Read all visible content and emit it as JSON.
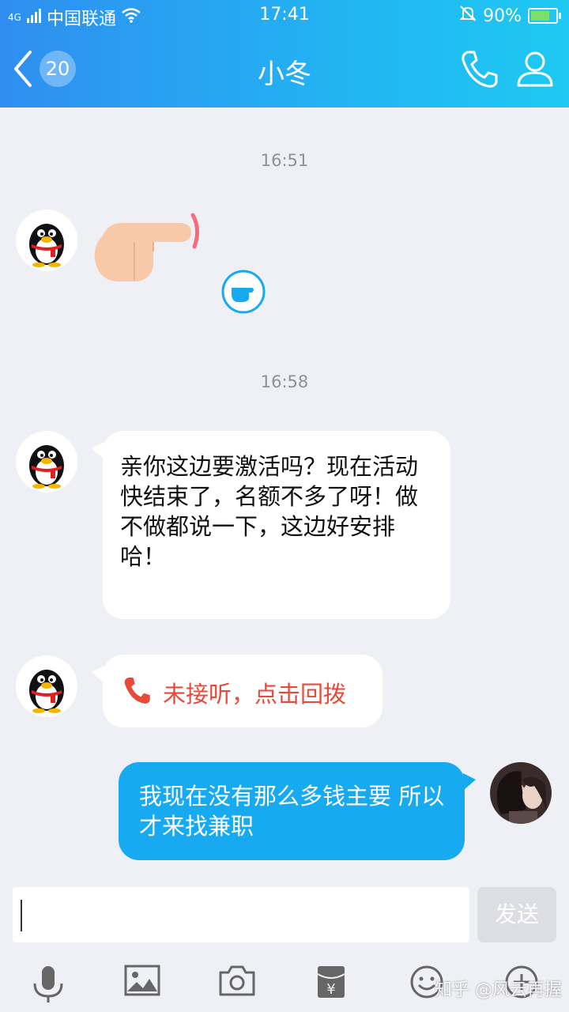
{
  "status_bar": {
    "signal_type": "4G",
    "carrier": "中国联通",
    "time": "17:41",
    "battery": "90%",
    "battery_level": 0.9
  },
  "header": {
    "unread_count": "20",
    "title": "小冬"
  },
  "messages": [
    {
      "timestamp": "16:51"
    },
    {
      "timestamp": "16:58"
    },
    {
      "text": "亲你这边要激活吗？现在活动快结束了，名额不多了呀！做不做都说一下，这边好安排哈！"
    },
    {
      "text": "未接听，点击回拨"
    },
    {
      "text": "我现在没有那么多钱主要 所以才来找兼职"
    }
  ],
  "input": {
    "value": "",
    "send_label": "发送"
  },
  "watermark": "知乎 @风云再握",
  "colors": {
    "header_start": "#2f8ef0",
    "header_end": "#1ec9f2",
    "outgoing_bubble": "#17aaf0",
    "missed_call": "#e84a38",
    "background": "#eef0f5"
  },
  "icons": [
    "back-chevron-icon",
    "phone-icon",
    "person-icon",
    "pointing-hand-icon",
    "poke-icon",
    "missed-call-icon",
    "mic-icon",
    "image-icon",
    "camera-icon",
    "red-packet-icon",
    "emoji-icon",
    "plus-icon"
  ]
}
